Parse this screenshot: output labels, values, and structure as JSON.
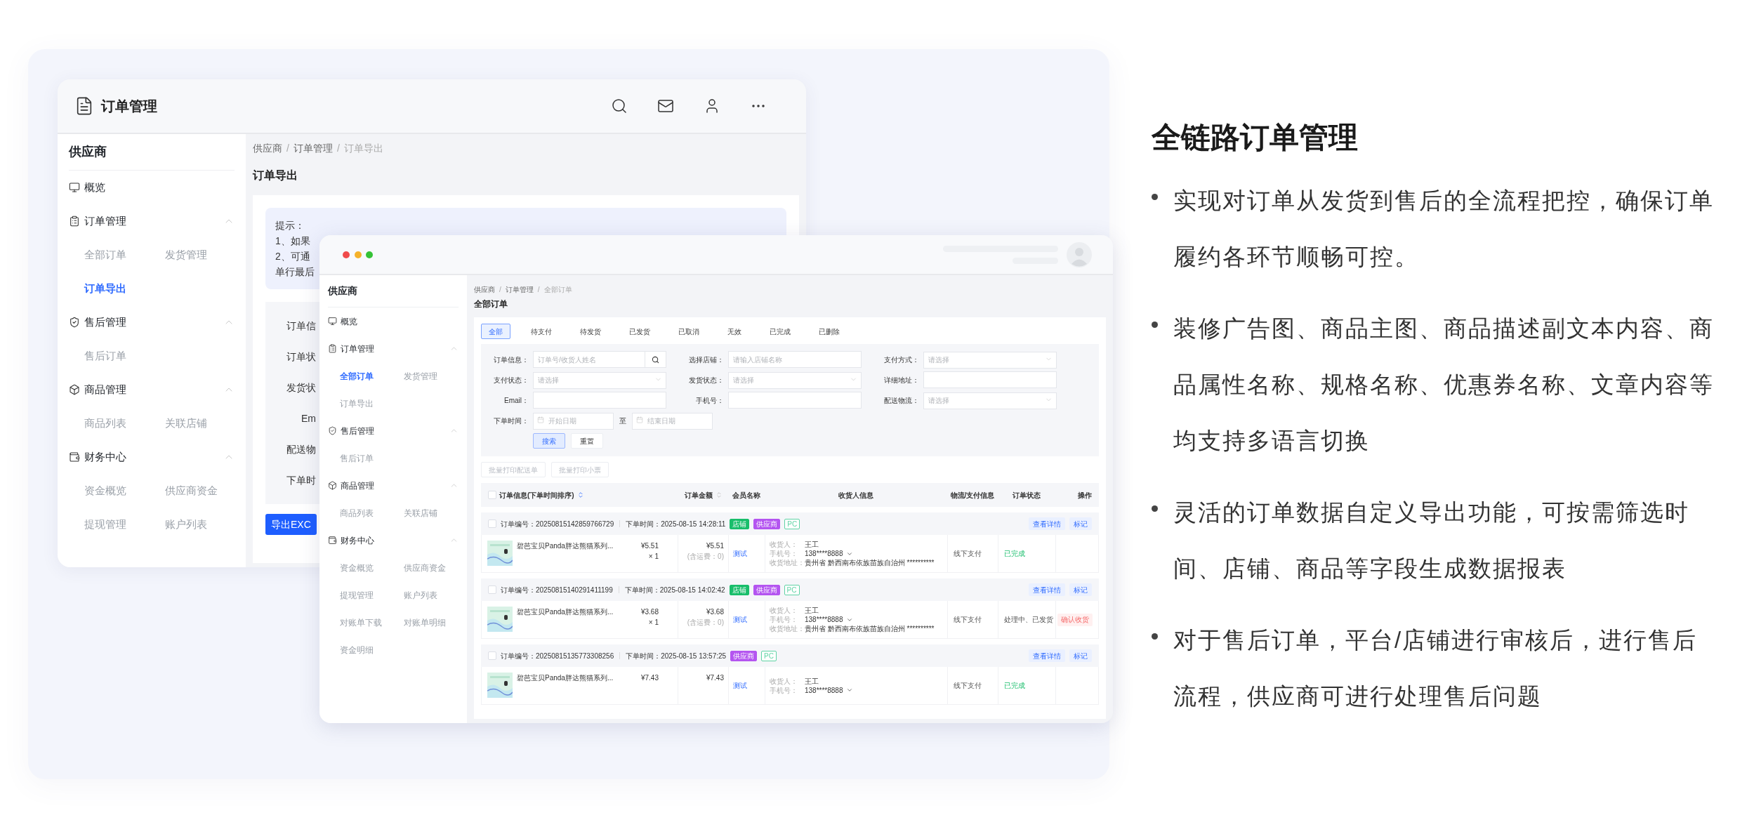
{
  "back_window": {
    "title": "订单管理",
    "sidebar": {
      "title": "供应商",
      "groups": [
        {
          "label": "概览"
        },
        {
          "label": "订单管理",
          "expanded": true,
          "children": [
            {
              "label": "全部订单",
              "selected": false
            },
            {
              "label": "发货管理",
              "selected": false
            },
            {
              "label": "订单导出",
              "selected": true
            }
          ]
        },
        {
          "label": "售后管理",
          "expanded": true,
          "children": [
            {
              "label": "售后订单",
              "selected": false
            }
          ]
        },
        {
          "label": "商品管理",
          "expanded": true,
          "children": [
            {
              "label": "商品列表",
              "selected": false
            },
            {
              "label": "关联店铺",
              "selected": false
            }
          ]
        },
        {
          "label": "财务中心",
          "expanded": true,
          "children": [
            {
              "label": "资金概览",
              "selected": false
            },
            {
              "label": "供应商资金",
              "selected": false
            },
            {
              "label": "提现管理",
              "selected": false
            },
            {
              "label": "账户列表",
              "selected": false
            }
          ]
        }
      ]
    },
    "breadcrumb": [
      "供应商",
      "订单管理",
      "订单导出"
    ],
    "breadcrumb_separator": "/",
    "page_title": "订单导出",
    "tip_lines": [
      "提示：",
      "1、如果",
      "2、可通",
      "单行最后"
    ],
    "form_labels": [
      "订单信",
      "订单状",
      "发货状",
      "Em",
      "配送物",
      "下单时"
    ],
    "export_button": "导出EXC"
  },
  "front_window": {
    "sidebar": {
      "title": "供应商",
      "groups": [
        {
          "label": "概览"
        },
        {
          "label": "订单管理",
          "expanded": true,
          "children": [
            {
              "label": "全部订单",
              "selected": true
            },
            {
              "label": "发货管理",
              "selected": false
            },
            {
              "label": "订单导出",
              "selected": false
            }
          ]
        },
        {
          "label": "售后管理",
          "expanded": true,
          "children": [
            {
              "label": "售后订单",
              "selected": false
            }
          ]
        },
        {
          "label": "商品管理",
          "expanded": true,
          "children": [
            {
              "label": "商品列表",
              "selected": false
            },
            {
              "label": "关联店铺",
              "selected": false
            }
          ]
        },
        {
          "label": "财务中心",
          "expanded": true,
          "children": [
            {
              "label": "资金概览",
              "selected": false
            },
            {
              "label": "供应商资金",
              "selected": false
            },
            {
              "label": "提现管理",
              "selected": false
            },
            {
              "label": "账户列表",
              "selected": false
            },
            {
              "label": "对账单下载",
              "selected": false
            },
            {
              "label": "对账单明细",
              "selected": false
            },
            {
              "label": "资金明细",
              "selected": false
            }
          ]
        }
      ]
    },
    "breadcrumb": [
      "供应商",
      "订单管理",
      "全部订单"
    ],
    "breadcrumb_separator": "/",
    "page_title": "全部订单",
    "tabs": [
      {
        "label": "全部",
        "selected": true
      },
      {
        "label": "待支付",
        "selected": false
      },
      {
        "label": "待发货",
        "selected": false
      },
      {
        "label": "已发货",
        "selected": false
      },
      {
        "label": "已取消",
        "selected": false
      },
      {
        "label": "无效",
        "selected": false
      },
      {
        "label": "已完成",
        "selected": false
      },
      {
        "label": "已删除",
        "selected": false
      }
    ],
    "filters": [
      [
        {
          "label": "订单信息：",
          "kind": "search",
          "placeholder": "订单号/收货人姓名"
        },
        {
          "label": "选择店铺：",
          "kind": "text",
          "placeholder": "请输入店铺名称"
        },
        {
          "label": "支付方式：",
          "kind": "select",
          "placeholder": "请选择"
        }
      ],
      [
        {
          "label": "支付状态：",
          "kind": "select",
          "placeholder": "请选择"
        },
        {
          "label": "发货状态：",
          "kind": "select",
          "placeholder": "请选择"
        },
        {
          "label": "详细地址：",
          "kind": "text"
        }
      ],
      [
        {
          "label": "Email：",
          "kind": "text"
        },
        {
          "label": "手机号：",
          "kind": "text"
        },
        {
          "label": "配送物流：",
          "kind": "select",
          "placeholder": "请选择"
        }
      ],
      [
        {
          "label": "下单时间：",
          "kind": "date_range",
          "from": {
            "placeholder": "开始日期"
          },
          "separator": "至",
          "to": {
            "placeholder": "结束日期"
          }
        }
      ]
    ],
    "filter_buttons": [
      {
        "label": "搜索",
        "kind": "primary"
      },
      {
        "label": "重置",
        "kind": "plain"
      }
    ],
    "batch_buttons": [
      {
        "label": "批量打印配送单",
        "disabled": true
      },
      {
        "label": "批量打印小票",
        "disabled": true
      }
    ],
    "table": {
      "checked": false,
      "columns": [
        {
          "label": "订单信息(下单时间排序)",
          "sortable": true,
          "sorted": true
        },
        {
          "label": "订单金额",
          "sortable": true,
          "sorted": false
        },
        {
          "label": "会员名称"
        },
        {
          "label": "收货人信息"
        },
        {
          "label": "物流/支付信息"
        },
        {
          "label": "订单状态"
        },
        {
          "label": "操作"
        }
      ],
      "orders": [
        {
          "checked": false,
          "order_no": "订单编号：20250815142859766729",
          "time": "下单时间：2025-08-15 14:28:11",
          "tags": [
            {
              "text": "店铺",
              "kind": "filled",
              "color": "#19be6b"
            },
            {
              "text": "供应商",
              "kind": "filled",
              "color": "#b455f0"
            },
            {
              "text": "PC",
              "kind": "outline",
              "color": "#5fd3a5"
            }
          ],
          "actions": [
            "查看详情",
            "标记"
          ],
          "product": "碧芭宝贝Panda胖达熊猫系列...",
          "unit_price": "¥5.51",
          "quantity": "× 1",
          "total": "¥5.51",
          "shipping": "(含运费：0)",
          "member": "测试",
          "receiver": [
            {
              "label": "收货人：",
              "value": "王工"
            },
            {
              "label": "手机号：",
              "value": "138****8888",
              "kind": "phone"
            },
            {
              "label": "收货地址：",
              "value": "贵州省 黔西南布依族苗族自治州 **********"
            }
          ],
          "payment": "线下支付",
          "status": {
            "text": "已完成",
            "kind": "done"
          }
        },
        {
          "checked": false,
          "order_no": "订单编号：20250815140291411199",
          "time": "下单时间：2025-08-15 14:02:42",
          "tags": [
            {
              "text": "店铺",
              "kind": "filled",
              "color": "#19be6b"
            },
            {
              "text": "供应商",
              "kind": "filled",
              "color": "#b455f0"
            },
            {
              "text": "PC",
              "kind": "outline",
              "color": "#5fd3a5"
            }
          ],
          "actions": [
            "查看详情",
            "标记"
          ],
          "product": "碧芭宝贝Panda胖达熊猫系列...",
          "unit_price": "¥3.68",
          "quantity": "× 1",
          "total": "¥3.68",
          "shipping": "(含运费：0)",
          "member": "测试",
          "receiver": [
            {
              "label": "收货人：",
              "value": "王工"
            },
            {
              "label": "手机号：",
              "value": "138****8888",
              "kind": "phone"
            },
            {
              "label": "收货地址：",
              "value": "贵州省 黔西南布依族苗族自治州 **********"
            }
          ],
          "payment": "线下支付",
          "status": {
            "text": "处理中、已发货",
            "kind": "processing"
          },
          "row_action": "确认收货"
        },
        {
          "checked": false,
          "order_no": "订单编号：20250815135773308256",
          "time": "下单时间：2025-08-15 13:57:25",
          "tags": [
            {
              "text": "供应商",
              "kind": "filled",
              "color": "#b455f0"
            },
            {
              "text": "PC",
              "kind": "outline",
              "color": "#5fd3a5"
            }
          ],
          "actions": [
            "查看详情",
            "标记"
          ],
          "product": "碧芭宝贝Panda胖达熊猫系列...",
          "unit_price": "¥7.43",
          "total": "¥7.43",
          "member": "测试",
          "receiver": [
            {
              "label": "收货人：",
              "value": "王工"
            },
            {
              "label": "手机号：",
              "value": "138****8888",
              "kind": "phone"
            }
          ],
          "payment": "线下支付",
          "status": {
            "text": "已完成",
            "kind": "done"
          }
        }
      ]
    }
  },
  "feature": {
    "title": "全链路订单管理",
    "bullets": [
      "实现对订单从发货到售后的全流程把控，确保订单履约各环节顺畅可控。",
      "装修广告图、商品主图、商品描述副文本内容、商品属性名称、规格名称、优惠券名称、文章内容等均支持多语言切换",
      "灵活的订单数据自定义导出功能，可按需筛选时间、店铺、商品等字段生成数据报表",
      "对于售后订单，平台/店铺进行审核后，进行售后流程，供应商可进行处理售后问题"
    ]
  }
}
